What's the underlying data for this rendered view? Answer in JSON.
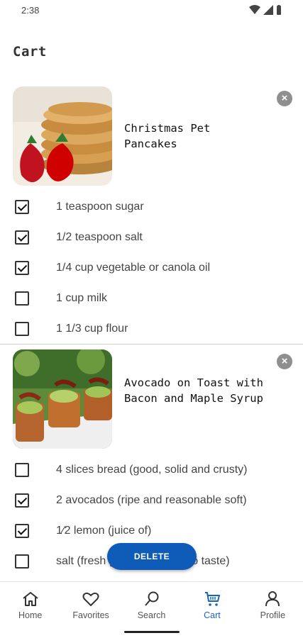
{
  "status": {
    "time": "2:38"
  },
  "page": {
    "title": "Cart"
  },
  "recipes": [
    {
      "title": "Christmas Pet Pancakes",
      "remove_icon": "close-circle-icon",
      "ingredients": [
        {
          "label": "1 teaspoon sugar",
          "checked": true
        },
        {
          "label": "1/2 teaspoon salt",
          "checked": true
        },
        {
          "label": "1/4 cup vegetable or canola oil",
          "checked": true
        },
        {
          "label": "1 cup milk",
          "checked": false
        },
        {
          "label": "1 1/3 cup flour",
          "checked": false
        }
      ]
    },
    {
      "title": "Avocado on Toast with Bacon and Maple Syrup",
      "remove_icon": "close-circle-icon",
      "ingredients": [
        {
          "label": "4 slices bread (good, solid and crusty)",
          "checked": false
        },
        {
          "label": "2 avocados (ripe and reasonable soft)",
          "checked": true
        },
        {
          "label": "1⁄2 lemon (juice of)",
          "checked": true
        },
        {
          "label": "salt (fresh ground pepper, to taste)",
          "checked": false
        }
      ]
    }
  ],
  "delete_button": {
    "label": "DELETE"
  },
  "nav": {
    "items": [
      {
        "label": "Home",
        "icon": "home-icon"
      },
      {
        "label": "Favorites",
        "icon": "heart-icon"
      },
      {
        "label": "Search",
        "icon": "search-icon"
      },
      {
        "label": "Cart",
        "icon": "cart-icon",
        "active": true
      },
      {
        "label": "Profile",
        "icon": "profile-icon"
      }
    ]
  },
  "colors": {
    "accent": "#0f5bb8",
    "nav_active": "#1565c0"
  }
}
